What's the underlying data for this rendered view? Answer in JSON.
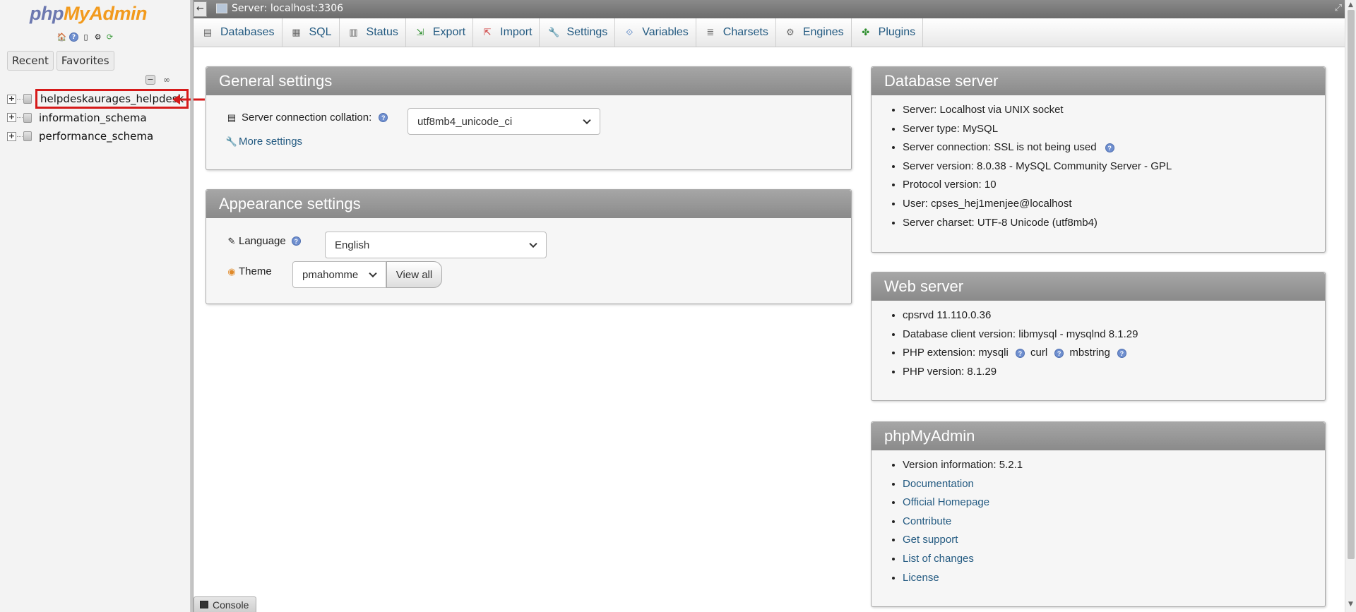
{
  "logo": {
    "php": "php",
    "rest": "MyAdmin"
  },
  "nav": {
    "icons": [
      "home-icon",
      "help-icon",
      "docs-icon",
      "settings-icon",
      "reload-icon"
    ],
    "tabs": [
      {
        "label": "Recent"
      },
      {
        "label": "Favorites"
      }
    ],
    "collapse_symbol": "−",
    "databases": [
      {
        "name": "helpdeskaurages_helpdesk",
        "highlighted": true
      },
      {
        "name": "information_schema",
        "highlighted": false
      },
      {
        "name": "performance_schema",
        "highlighted": false
      }
    ]
  },
  "topbar": {
    "server": "Server: localhost:3306",
    "back": "←",
    "collapse": "⤢"
  },
  "menu": [
    {
      "label": "Databases",
      "icon": "database-icon"
    },
    {
      "label": "SQL",
      "icon": "sql-icon"
    },
    {
      "label": "Status",
      "icon": "status-icon"
    },
    {
      "label": "Export",
      "icon": "export-icon"
    },
    {
      "label": "Import",
      "icon": "import-icon"
    },
    {
      "label": "Settings",
      "icon": "wrench-icon"
    },
    {
      "label": "Variables",
      "icon": "variables-icon"
    },
    {
      "label": "Charsets",
      "icon": "charsets-icon"
    },
    {
      "label": "Engines",
      "icon": "engines-icon"
    },
    {
      "label": "Plugins",
      "icon": "plugins-icon"
    }
  ],
  "general": {
    "title": "General settings",
    "collation_label": "Server connection collation:",
    "collation_value": "utf8mb4_unicode_ci",
    "more_settings": "More settings"
  },
  "appearance": {
    "title": "Appearance settings",
    "language_label": "Language",
    "language_value": "English",
    "theme_label": "Theme",
    "theme_value": "pmahomme",
    "view_all": "View all"
  },
  "db_server": {
    "title": "Database server",
    "items": [
      "Server: Localhost via UNIX socket",
      "Server type: MySQL",
      "Server connection: SSL is not being used",
      "Server version: 8.0.38 - MySQL Community Server - GPL",
      "Protocol version: 10",
      "User: cpses_hej1menjee@localhost",
      "Server charset: UTF-8 Unicode (utf8mb4)"
    ]
  },
  "web_server": {
    "title": "Web server",
    "items": [
      "cpsrvd 11.110.0.36",
      "Database client version: libmysql - mysqlnd 8.1.29",
      "PHP version: 8.1.29"
    ],
    "php_ext_label": "PHP extension:",
    "php_ext": [
      "mysqli",
      "curl",
      "mbstring"
    ]
  },
  "pma": {
    "title": "phpMyAdmin",
    "version": "Version information: 5.2.1",
    "links": [
      "Documentation",
      "Official Homepage",
      "Contribute",
      "Get support",
      "List of changes",
      "License"
    ]
  },
  "console": {
    "label": "Console"
  },
  "colors": {
    "link": "#235a81",
    "highlight": "#d61a1a",
    "logo_php": "#6c78b0",
    "logo_rest": "#f29a1d"
  }
}
